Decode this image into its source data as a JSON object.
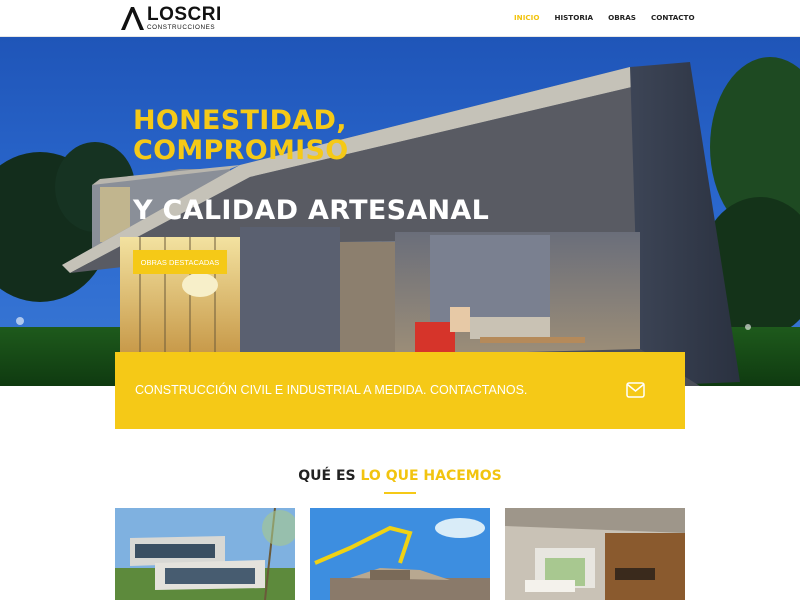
{
  "brand": {
    "name": "LOSCRI",
    "subtitle": "CONSTRUCCIONES",
    "accent_color": "#f5c917"
  },
  "nav": {
    "items": [
      {
        "label": "INICIO",
        "active": true
      },
      {
        "label": "HISTORIA",
        "active": false
      },
      {
        "label": "OBRAS",
        "active": false
      },
      {
        "label": "CONTACTO",
        "active": false
      }
    ]
  },
  "hero": {
    "headline_1": "HONESTIDAD, COMPROMISO",
    "headline_2": "Y CALIDAD ARTESANAL",
    "button_label": "OBRAS DESTACADAS"
  },
  "cta": {
    "text": "CONSTRUCCIÓN CIVIL E INDUSTRIAL A MEDIDA. CONTACTANOS.",
    "icon": "envelope-icon"
  },
  "section": {
    "title_prefix": "QUÉ ES ",
    "title_highlight": "LO QUE HACEMOS"
  },
  "cards": [
    {
      "image": "modern-house-photo"
    },
    {
      "image": "concrete-pump-construction-photo"
    },
    {
      "image": "interior-living-room-photo"
    }
  ]
}
